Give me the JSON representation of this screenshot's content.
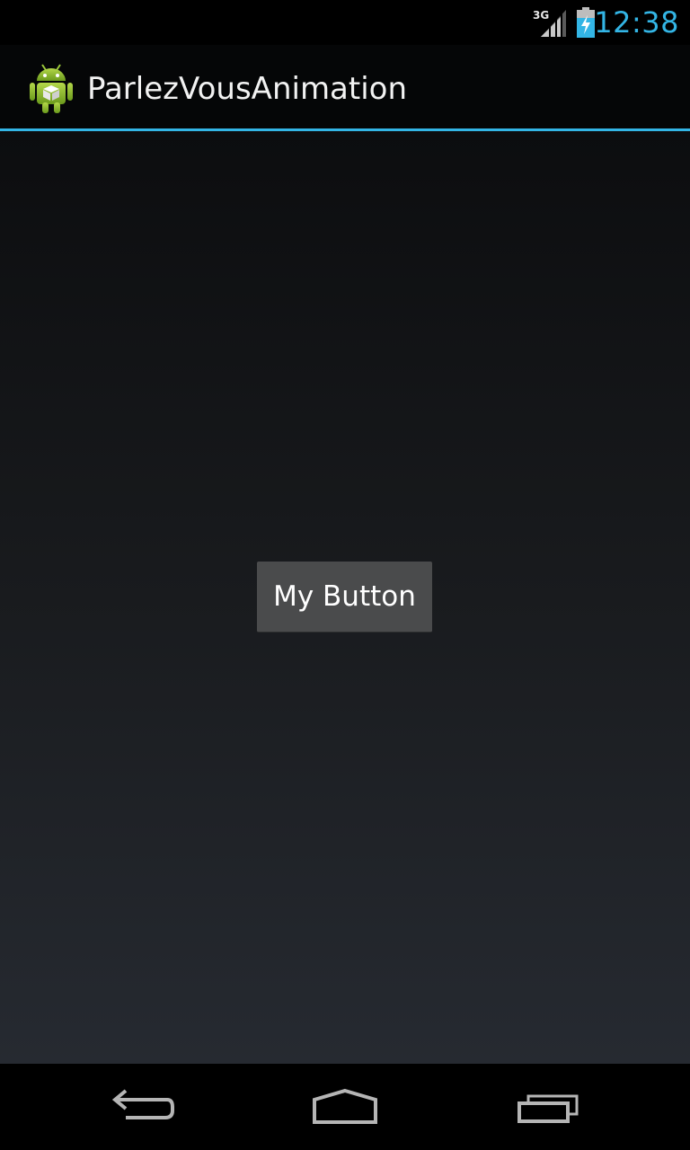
{
  "status_bar": {
    "network_type": "3G",
    "network_icon": "signal-icon",
    "battery_icon": "battery-charging-icon",
    "time": "12:38",
    "accent_color": "#33b5e5"
  },
  "action_bar": {
    "app_icon": "android-app-icon",
    "title": "ParlezVousAnimation",
    "underline_color": "#33b5e5"
  },
  "main": {
    "button_label": "My Button"
  },
  "nav_bar": {
    "back_icon": "back-icon",
    "home_icon": "home-icon",
    "recents_icon": "recent-apps-icon"
  }
}
